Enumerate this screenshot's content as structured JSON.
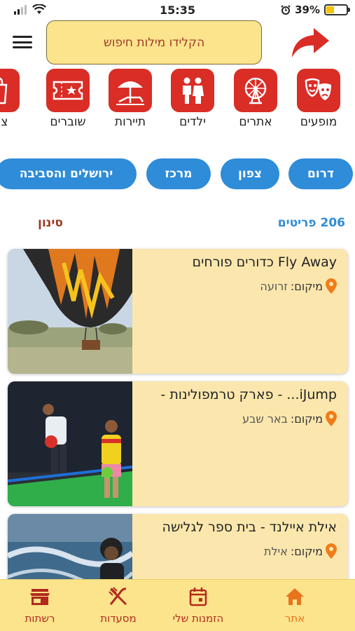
{
  "status_bar": {
    "time": "15:35",
    "battery": "39%",
    "battery_level": 0.39
  },
  "search": {
    "placeholder": "הקלידו מילות חיפוש"
  },
  "categories": [
    {
      "label": "מופעים",
      "icon": "theater-masks-icon"
    },
    {
      "label": "אתרים",
      "icon": "ferris-wheel-icon"
    },
    {
      "label": "ילדים",
      "icon": "family-icon"
    },
    {
      "label": "תיירות",
      "icon": "beach-umbrella-icon"
    },
    {
      "label": "שוברים",
      "icon": "ticket-icon"
    },
    {
      "label": "צרכ",
      "icon": "shopping-bag-icon"
    }
  ],
  "regions": [
    "דרום",
    "צפון",
    "מרכז",
    "ירושלים והסביבה"
  ],
  "results": {
    "count": "206 פריטים",
    "filter_label": "סינון"
  },
  "location_prefix": "מיקום:",
  "listings": [
    {
      "title": "Fly Away כדורים פורחים",
      "location": "זרועה"
    },
    {
      "title": "iJump... - פארק טרמפולינות -",
      "location": "באר שבע"
    },
    {
      "title": "אילת איילנד - בית ספר לגלישה",
      "location": "אילת"
    }
  ],
  "bottom_nav": [
    {
      "label": "אתר",
      "icon": "home-icon",
      "active": true
    },
    {
      "label": "הזמנות שלי",
      "icon": "calendar-icon",
      "active": false
    },
    {
      "label": "מסעדות",
      "icon": "fork-knife-icon",
      "active": false
    },
    {
      "label": "רשתות",
      "icon": "store-icon",
      "active": false
    }
  ],
  "colors": {
    "accent_red": "#d92d26",
    "region_blue": "#2e8cd8",
    "card_bg": "#fbe7ad",
    "nav_bg": "#fce48c",
    "active_orange": "#e8731c"
  }
}
